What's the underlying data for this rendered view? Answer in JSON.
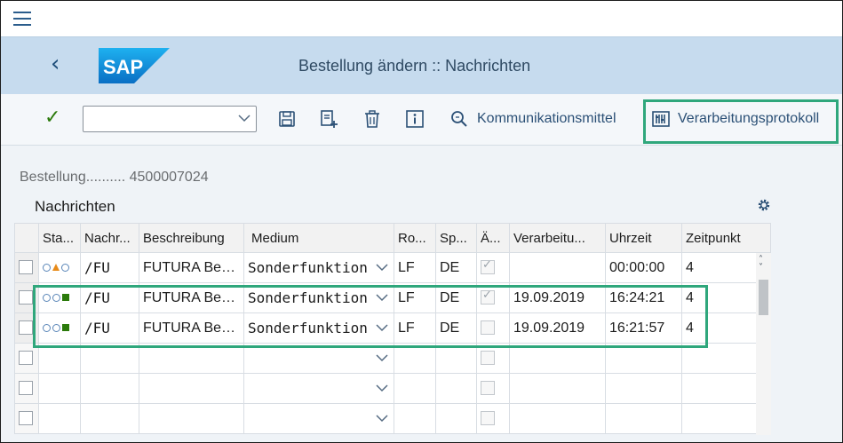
{
  "app": {
    "title": "Bestellung ändern :: Nachrichten",
    "logo_text": "SAP"
  },
  "toolbar": {
    "combo_value": "",
    "kommunikation_label": "Kommunikationsmittel",
    "protokoll_label": "Verarbeitungsprotokoll"
  },
  "header": {
    "bestellung_label": "Bestellung..........",
    "bestellung_value": "4500007024"
  },
  "section": {
    "title": "Nachrichten"
  },
  "table": {
    "columns": [
      "Sta...",
      "Nachr...",
      "Beschreibung",
      "Medium",
      "Ro...",
      "Sp...",
      "Ä...",
      "Verarbeitu...",
      "Uhrzeit",
      "Zeitpunkt"
    ],
    "rows": [
      {
        "status": "yellow",
        "nachricht": "/FU",
        "beschreibung": "FUTURA Best...",
        "medium": "Sonderfunktion",
        "rolle": "LF",
        "sprache": "DE",
        "geaendert": true,
        "datum": "",
        "uhrzeit": "00:00:00",
        "zeitpunkt": "4"
      },
      {
        "status": "green",
        "nachricht": "/FU",
        "beschreibung": "FUTURA Best...",
        "medium": "Sonderfunktion",
        "rolle": "LF",
        "sprache": "DE",
        "geaendert": true,
        "datum": "19.09.2019",
        "uhrzeit": "16:24:21",
        "zeitpunkt": "4"
      },
      {
        "status": "green",
        "nachricht": "/FU",
        "beschreibung": "FUTURA Best...",
        "medium": "Sonderfunktion",
        "rolle": "LF",
        "sprache": "DE",
        "geaendert": false,
        "datum": "19.09.2019",
        "uhrzeit": "16:21:57",
        "zeitpunkt": "4"
      }
    ],
    "empty_rows": 3
  },
  "colors": {
    "accent": "#2b5d8c",
    "highlight": "#2fa77c",
    "status_green": "#2b7a0b",
    "status_yellow": "#e88b1a"
  }
}
